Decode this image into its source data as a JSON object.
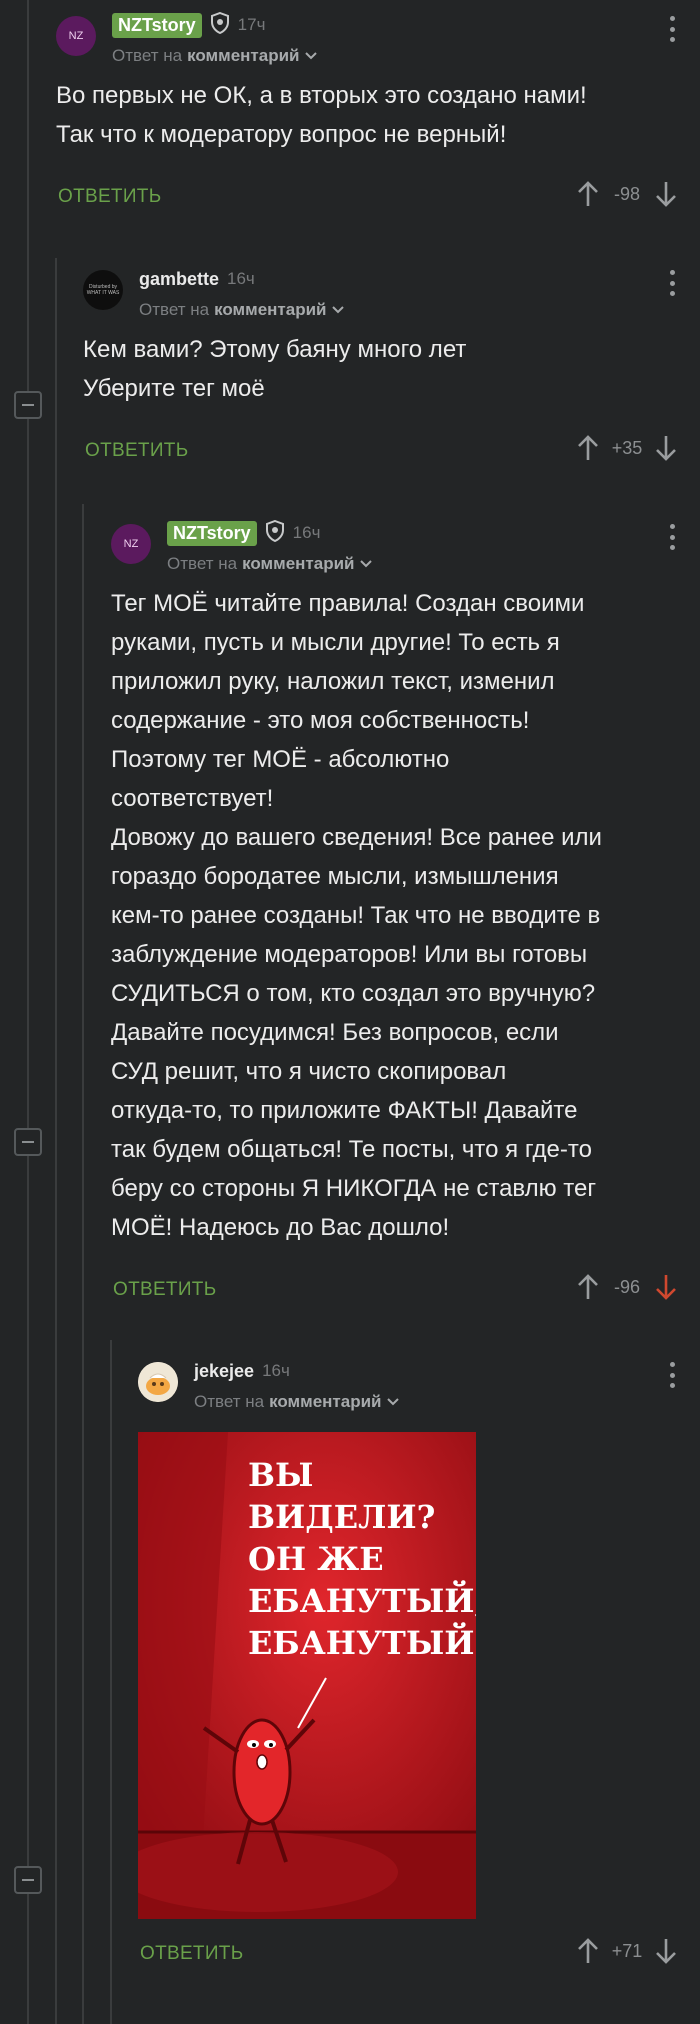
{
  "comments": [
    {
      "nick": "NZTstory",
      "avatar_text": "NZ",
      "time": "17ч",
      "reply_prefix": "Ответ на",
      "reply_target": "комментарий",
      "text": "Во первых не ОК, а в вторых это создано нами!\nТак что к модератору вопрос не верный!",
      "reply_label": "ОТВЕТИТЬ",
      "rating": "-98"
    },
    {
      "nick": "gambette",
      "avatar_text": "Disturbed by\nWHAT IT WAS",
      "time": "16ч",
      "reply_prefix": "Ответ на",
      "reply_target": "комментарий",
      "text": "Кем вами? Этому баяну много лет\nУберите тег моё",
      "reply_label": "ОТВЕТИТЬ",
      "rating": "+35"
    },
    {
      "nick": "NZTstory",
      "avatar_text": "NZ",
      "time": "16ч",
      "reply_prefix": "Ответ на",
      "reply_target": "комментарий",
      "text": "Тег МОЁ читайте правила! Создан своими\nруками, пусть и мысли другие! То есть я\nприложил руку, наложил текст, изменил\nсодержание - это моя собственность!\nПоэтому тег МОЁ - абсолютно\nсоответствует!\nДовожу до вашего сведения! Все ранее или\nгораздо бородатее мысли, измышления\nкем-то ранее созданы! Так что не вводите в\nзаблуждение модераторов! Или вы готовы\nСУДИТЬСЯ о том, кто создал это вручную?\nДавайте посудимся! Без вопросов, если\nСУД решит, что я чисто скопировал\nоткуда-то, то приложите ФАКТЫ! Давайте\nтак будем общаться! Те посты, что я где-то\nберу со стороны Я НИКОГДА не ставлю тег\nМОЁ! Надеюсь до Вас дошло!",
      "reply_label": "ОТВЕТИТЬ",
      "rating": "-96"
    },
    {
      "nick": "jekejee",
      "time": "16ч",
      "reply_prefix": "Ответ на",
      "reply_target": "комментарий",
      "meme_lines": [
        "ВЫ",
        "ВИДЕЛИ?",
        "ОН ЖЕ",
        "ЕБАНУТЫЙ,",
        "ЕБАНУТЫЙ!"
      ],
      "reply_label": "ОТВЕТИТЬ",
      "rating": "+71"
    }
  ],
  "colors": {
    "background": "#232526",
    "accent_green": "#6aa14a",
    "downvote_active": "#d0482f",
    "meme_red": "#c8141a"
  },
  "icons": [
    "shield-icon",
    "chevron-down-icon",
    "more-icon",
    "upvote-icon",
    "downvote-icon",
    "collapse-icon"
  ]
}
